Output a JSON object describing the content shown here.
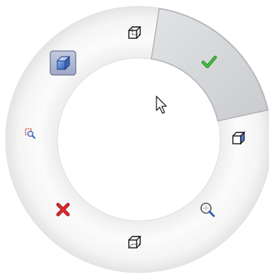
{
  "radial_menu": {
    "selected_item": "ok",
    "items": [
      {
        "id": "ok",
        "icon": "green-checkmark-icon",
        "tooltip": ""
      },
      {
        "id": "view-top",
        "icon": "wireframe-cube-icon",
        "tooltip": ""
      },
      {
        "id": "shaded-display",
        "icon": "shaded-cube-icon",
        "tooltip": ""
      },
      {
        "id": "zoom-to-selection",
        "icon": "zoom-to-selection-icon",
        "tooltip": ""
      },
      {
        "id": "cancel",
        "icon": "red-x-icon",
        "tooltip": ""
      },
      {
        "id": "view-bottom",
        "icon": "wireframe-cube-icon",
        "tooltip": ""
      },
      {
        "id": "zoom-to-fit",
        "icon": "zoom-magnifier-icon",
        "tooltip": ""
      },
      {
        "id": "view-right",
        "icon": "wireframe-cube-icon",
        "tooltip": ""
      }
    ]
  },
  "colors": {
    "ring_light": "#fbfbfb",
    "ring_dark": "#e6e6e6",
    "selected_segment": "#d4d6d9",
    "checkmark": "#2eaa2e",
    "cancel": "#d8262a",
    "cube_blue": "#4a78c8",
    "highlight_tile": "#aab2cf"
  },
  "cursor": {
    "icon": "mouse-pointer-icon"
  }
}
